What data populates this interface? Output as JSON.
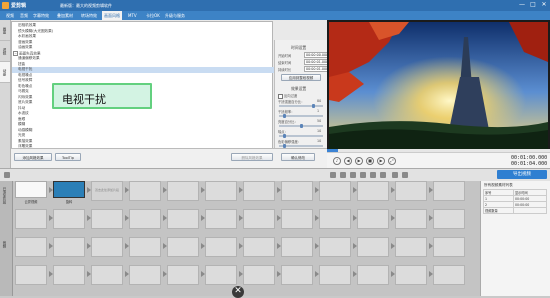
{
  "window": {
    "app_name": "爱剪辑",
    "doc_title": "最新版：最大的视频剪辑软件",
    "controls": [
      "—",
      "□",
      "✕"
    ]
  },
  "menu": [
    {
      "label": "视频",
      "active": false
    },
    {
      "label": "音频",
      "active": false
    },
    {
      "label": "字幕特效",
      "active": false
    },
    {
      "label": "叠加素材",
      "active": false
    },
    {
      "label": "转场特效",
      "active": false
    },
    {
      "label": "画面风格",
      "active": true
    },
    {
      "label": "MTV",
      "active": false
    },
    {
      "label": "卡拉OK",
      "active": false
    },
    {
      "label": "升级与服务",
      "active": false
    }
  ],
  "side_tabs": [
    "画面",
    "滤镜",
    "动景"
  ],
  "tree": [
    {
      "label": "旧相机效果",
      "level": 1,
      "selected": false
    },
    {
      "label": "镜头模糊(大光圈效果)",
      "level": 1,
      "selected": false
    },
    {
      "label": "水彩画效果",
      "level": 1,
      "selected": false
    },
    {
      "label": "漫画效果",
      "level": 1,
      "selected": false
    },
    {
      "label": "油画效果",
      "level": 1,
      "selected": false
    },
    {
      "label": "画面失真效果",
      "level": 0,
      "selected": false
    },
    {
      "label": "通道偏移效果",
      "level": 1,
      "selected": false
    },
    {
      "label": "扭曲",
      "level": 1,
      "selected": false
    },
    {
      "label": "电视干扰",
      "level": 1,
      "selected": true
    },
    {
      "label": "电视噪点",
      "level": 1,
      "selected": false
    },
    {
      "label": "信号故障",
      "level": 1,
      "selected": false
    },
    {
      "label": "彩色噪点",
      "level": 1,
      "selected": false
    },
    {
      "label": "马赛克",
      "level": 1,
      "selected": false
    },
    {
      "label": "闪烁效果",
      "level": 1,
      "selected": false
    },
    {
      "label": "底片效果",
      "level": 1,
      "selected": false
    },
    {
      "label": "抖动",
      "level": 1,
      "selected": false
    },
    {
      "label": "水波纹",
      "level": 1,
      "selected": false
    },
    {
      "label": "鱼眼",
      "level": 1,
      "selected": false
    },
    {
      "label": "模糊",
      "level": 1,
      "selected": false
    },
    {
      "label": "动感模糊",
      "level": 1,
      "selected": false
    },
    {
      "label": "光斑",
      "level": 1,
      "selected": false
    },
    {
      "label": "素描效果",
      "level": 1,
      "selected": false
    },
    {
      "label": "浮雕效果",
      "level": 1,
      "selected": false
    },
    {
      "label": "铅笔画",
      "level": 1,
      "selected": false
    },
    {
      "label": "网格",
      "level": 1,
      "selected": false
    },
    {
      "label": "热感",
      "level": 1,
      "selected": false
    },
    {
      "label": "光影节奏效果",
      "level": 0,
      "selected": false
    },
    {
      "label": "基本光效",
      "level": 1,
      "selected": false
    },
    {
      "label": "透射光效",
      "level": 1,
      "selected": false
    }
  ],
  "tooltip": {
    "text": "电视干扰"
  },
  "buttons": {
    "add_effect": "添加风格效果",
    "tool": "ToolTip",
    "delete": "删除风格效果",
    "confirm": "确认修改"
  },
  "settings": {
    "section_time": "时间设置",
    "start_label": "开始时间",
    "start_value": "00:00:00.000",
    "end_label": "结束时间",
    "end_value": "00:00:01.000",
    "duration_label": "持续时长",
    "duration_value": "00:00:01.000",
    "apply_range": "应用到整段视频",
    "section_effect": "效果设置",
    "check_reverse": "反向过渡",
    "slider1_label": "干扰强度百分比：",
    "slider1_value": "80",
    "slider2_label": "干扰频率：",
    "slider2_value": "1",
    "slider3_label": "亮度百分比：",
    "slider3_value": "50",
    "slider4_label": "噪点：",
    "slider4_value": "10",
    "slider5_label": "色彩偏移强度：",
    "slider5_value": "10",
    "check_reset": "自动随机干扰",
    "slider_fractions": {
      "s1": 0.8,
      "s2": 0.1,
      "s3": 0.5,
      "s4": 0.1,
      "s5": 0.1
    }
  },
  "player": {
    "progress": 0.05,
    "time_current": "00:01:00.000",
    "time_total": "00:01:04.000"
  },
  "toolbar": {
    "export": "导出视频"
  },
  "timeline": {
    "labels": [
      "已添加片段",
      "音频"
    ],
    "clips": [
      {
        "name": "云雾视频",
        "index": "1"
      },
      {
        "name": "旋转",
        "index": "2"
      }
    ],
    "placeholder": "双击此处添加片段"
  },
  "right_panel": {
    "title": "所有视频素材列表",
    "headers": [
      "序号",
      "显示时间"
    ],
    "rows": [
      [
        "1",
        "00:00:00"
      ],
      [
        "2",
        "00:00:00"
      ],
      [
        "视频数量",
        ""
      ]
    ]
  },
  "colors": {
    "accent": "#2f6fb0",
    "selected": "#c9dcf2",
    "tooltip_border": "#63d07f"
  }
}
